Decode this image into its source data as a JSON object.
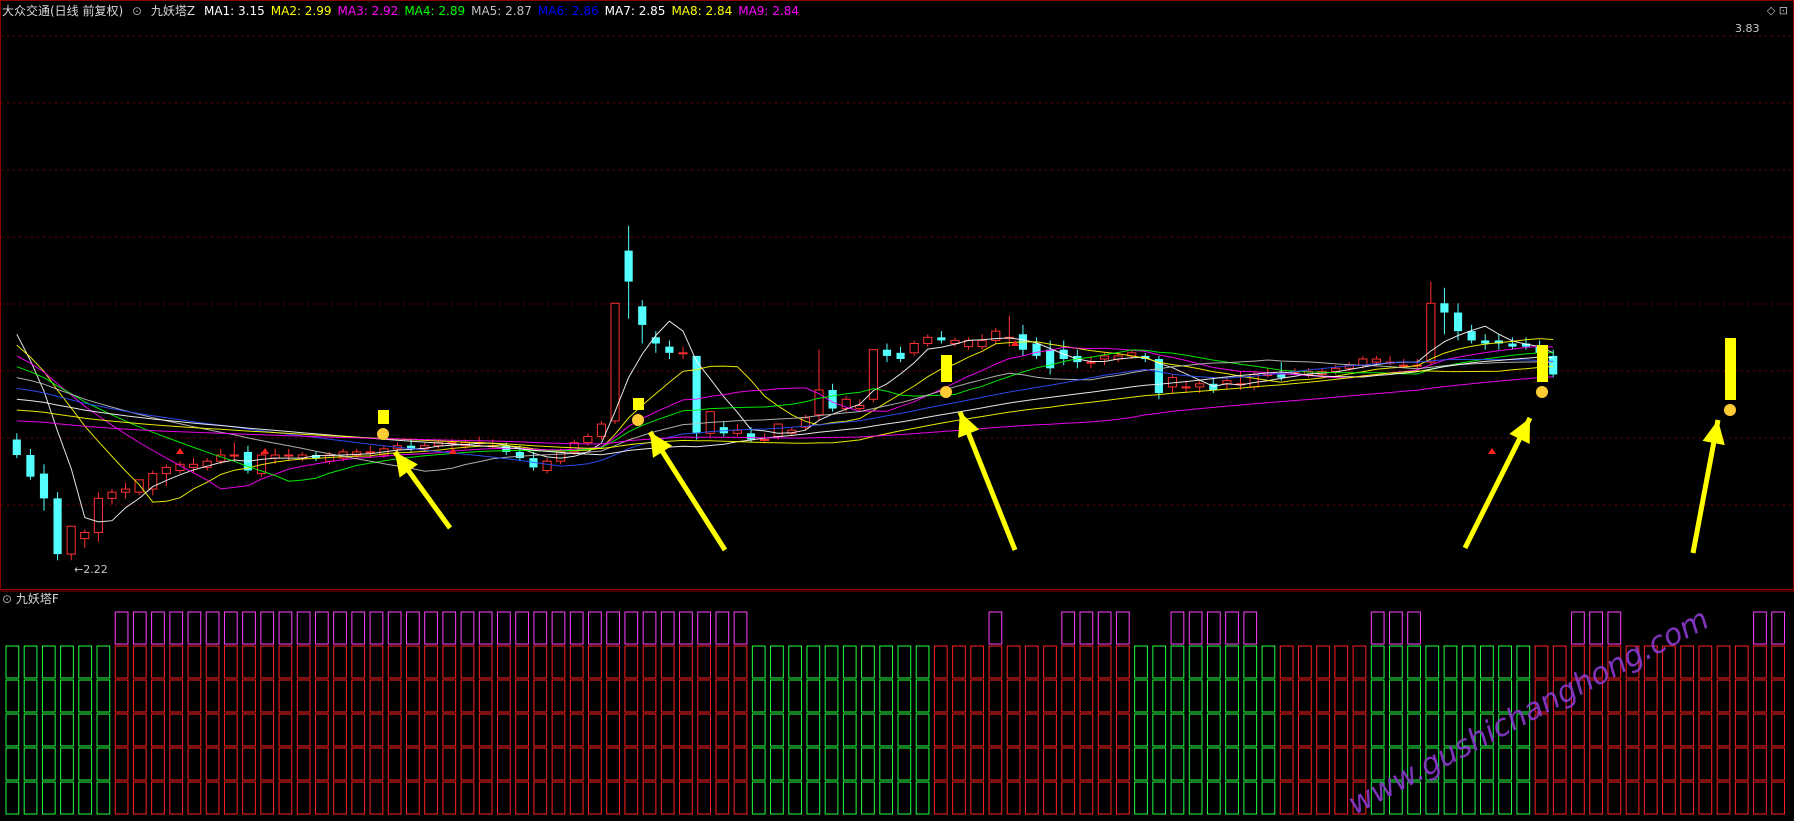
{
  "header": {
    "stock": "大众交通(日线 前复权)",
    "indicator": "九妖塔Z",
    "ma": [
      {
        "label": "MA1: 3.15",
        "color": "#ffffff"
      },
      {
        "label": "MA2: 2.99",
        "color": "#ffff00"
      },
      {
        "label": "MA3: 2.92",
        "color": "#ff00ff"
      },
      {
        "label": "MA4: 2.89",
        "color": "#00ff00"
      },
      {
        "label": "MA5: 2.87",
        "color": "#c0c0c0"
      },
      {
        "label": "MA6: 2.86",
        "color": "#0000ff"
      },
      {
        "label": "MA7: 2.85",
        "color": "#ffffff"
      },
      {
        "label": "MA8: 2.84",
        "color": "#ffff00"
      },
      {
        "label": "MA9: 2.84",
        "color": "#ff00ff"
      }
    ]
  },
  "sub_panel": {
    "title": "九妖塔F"
  },
  "watermark": "www.gushichanghong.com",
  "chart_data": {
    "type": "candlestick",
    "price_high_label": "3.83",
    "price_low_label": "←2.22",
    "ylim": [
      2.15,
      3.9
    ],
    "candles": [
      [
        2.61,
        2.63,
        2.56,
        2.55
      ],
      [
        2.56,
        2.58,
        2.49,
        2.48
      ],
      [
        2.5,
        2.53,
        2.42,
        2.38
      ],
      [
        2.42,
        2.44,
        2.24,
        2.22
      ],
      [
        2.24,
        2.33,
        2.33,
        2.22
      ],
      [
        2.29,
        2.32,
        2.31,
        2.26
      ],
      [
        2.31,
        2.44,
        2.42,
        2.28
      ],
      [
        2.42,
        2.45,
        2.44,
        2.4
      ],
      [
        2.44,
        2.47,
        2.45,
        2.42
      ],
      [
        2.44,
        2.48,
        2.48,
        2.43
      ],
      [
        2.45,
        2.51,
        2.5,
        2.43
      ],
      [
        2.5,
        2.53,
        2.52,
        2.46
      ],
      [
        2.51,
        2.54,
        2.53,
        2.5
      ],
      [
        2.52,
        2.55,
        2.53,
        2.5
      ],
      [
        2.52,
        2.55,
        2.54,
        2.51
      ],
      [
        2.54,
        2.58,
        2.56,
        2.53
      ],
      [
        2.56,
        2.6,
        2.56,
        2.54
      ],
      [
        2.57,
        2.59,
        2.51,
        2.5
      ],
      [
        2.5,
        2.57,
        2.56,
        2.49
      ],
      [
        2.55,
        2.58,
        2.56,
        2.53
      ],
      [
        2.56,
        2.58,
        2.56,
        2.54
      ],
      [
        2.55,
        2.57,
        2.56,
        2.54
      ],
      [
        2.56,
        2.57,
        2.55,
        2.54
      ],
      [
        2.54,
        2.57,
        2.56,
        2.53
      ],
      [
        2.55,
        2.58,
        2.57,
        2.54
      ],
      [
        2.56,
        2.58,
        2.57,
        2.55
      ],
      [
        2.57,
        2.59,
        2.57,
        2.55
      ],
      [
        2.56,
        2.59,
        2.58,
        2.55
      ],
      [
        2.58,
        2.6,
        2.59,
        2.56
      ],
      [
        2.59,
        2.61,
        2.58,
        2.57
      ],
      [
        2.58,
        2.6,
        2.59,
        2.57
      ],
      [
        2.59,
        2.61,
        2.6,
        2.58
      ],
      [
        2.6,
        2.61,
        2.6,
        2.58
      ],
      [
        2.59,
        2.61,
        2.6,
        2.58
      ],
      [
        2.6,
        2.62,
        2.6,
        2.59
      ],
      [
        2.59,
        2.61,
        2.59,
        2.58
      ],
      [
        2.59,
        2.6,
        2.57,
        2.56
      ],
      [
        2.57,
        2.59,
        2.55,
        2.54
      ],
      [
        2.55,
        2.57,
        2.52,
        2.51
      ],
      [
        2.51,
        2.55,
        2.54,
        2.5
      ],
      [
        2.54,
        2.58,
        2.57,
        2.53
      ],
      [
        2.57,
        2.61,
        2.6,
        2.56
      ],
      [
        2.6,
        2.63,
        2.62,
        2.59
      ],
      [
        2.62,
        2.67,
        2.66,
        2.61
      ],
      [
        2.67,
        3.05,
        3.05,
        2.66
      ],
      [
        3.22,
        3.3,
        3.12,
        3.0
      ],
      [
        3.04,
        3.06,
        2.98,
        2.92
      ],
      [
        2.94,
        2.96,
        2.92,
        2.89
      ],
      [
        2.91,
        2.93,
        2.89,
        2.87
      ],
      [
        2.89,
        2.91,
        2.89,
        2.87
      ],
      [
        2.88,
        2.88,
        2.63,
        2.61
      ],
      [
        2.63,
        2.7,
        2.7,
        2.62
      ],
      [
        2.65,
        2.67,
        2.63,
        2.62
      ],
      [
        2.63,
        2.66,
        2.64,
        2.62
      ],
      [
        2.63,
        2.65,
        2.61,
        2.6
      ],
      [
        2.61,
        2.63,
        2.61,
        2.6
      ],
      [
        2.62,
        2.66,
        2.66,
        2.61
      ],
      [
        2.63,
        2.65,
        2.64,
        2.62
      ],
      [
        2.65,
        2.69,
        2.68,
        2.64
      ],
      [
        2.69,
        2.9,
        2.77,
        2.67
      ],
      [
        2.77,
        2.79,
        2.71,
        2.7
      ],
      [
        2.71,
        2.75,
        2.74,
        2.7
      ],
      [
        2.71,
        2.74,
        2.72,
        2.7
      ],
      [
        2.74,
        2.9,
        2.9,
        2.73
      ],
      [
        2.9,
        2.92,
        2.88,
        2.86
      ],
      [
        2.89,
        2.91,
        2.87,
        2.86
      ],
      [
        2.89,
        2.93,
        2.92,
        2.88
      ],
      [
        2.92,
        2.95,
        2.94,
        2.91
      ],
      [
        2.94,
        2.96,
        2.93,
        2.92
      ],
      [
        2.92,
        2.94,
        2.93,
        2.91
      ],
      [
        2.91,
        2.94,
        2.93,
        2.9
      ],
      [
        2.91,
        2.95,
        2.93,
        2.9
      ],
      [
        2.93,
        2.97,
        2.96,
        2.92
      ],
      [
        2.94,
        3.01,
        2.94,
        2.91
      ],
      [
        2.95,
        2.98,
        2.9,
        2.88
      ],
      [
        2.92,
        2.94,
        2.88,
        2.87
      ],
      [
        2.9,
        2.93,
        2.84,
        2.82
      ],
      [
        2.9,
        2.93,
        2.87,
        2.85
      ],
      [
        2.88,
        2.9,
        2.86,
        2.84
      ],
      [
        2.86,
        2.88,
        2.86,
        2.84
      ],
      [
        2.87,
        2.89,
        2.88,
        2.85
      ],
      [
        2.87,
        2.89,
        2.88,
        2.86
      ],
      [
        2.88,
        2.9,
        2.89,
        2.87
      ],
      [
        2.88,
        2.89,
        2.87,
        2.86
      ],
      [
        2.87,
        2.88,
        2.76,
        2.74
      ],
      [
        2.78,
        2.82,
        2.81,
        2.76
      ],
      [
        2.78,
        2.8,
        2.78,
        2.76
      ],
      [
        2.78,
        2.8,
        2.79,
        2.76
      ],
      [
        2.79,
        2.81,
        2.77,
        2.76
      ],
      [
        2.79,
        2.81,
        2.8,
        2.77
      ],
      [
        2.79,
        2.83,
        2.79,
        2.77
      ],
      [
        2.78,
        2.83,
        2.82,
        2.77
      ],
      [
        2.82,
        2.84,
        2.82,
        2.81
      ],
      [
        2.82,
        2.86,
        2.81,
        2.8
      ],
      [
        2.83,
        2.84,
        2.83,
        2.82
      ],
      [
        2.82,
        2.84,
        2.83,
        2.81
      ],
      [
        2.82,
        2.84,
        2.83,
        2.81
      ],
      [
        2.83,
        2.85,
        2.84,
        2.82
      ],
      [
        2.84,
        2.86,
        2.85,
        2.83
      ],
      [
        2.85,
        2.88,
        2.87,
        2.84
      ],
      [
        2.86,
        2.88,
        2.87,
        2.85
      ],
      [
        2.86,
        2.88,
        2.86,
        2.85
      ],
      [
        2.85,
        2.87,
        2.85,
        2.84
      ],
      [
        2.85,
        2.87,
        2.85,
        2.84
      ],
      [
        2.86,
        3.12,
        3.05,
        2.85
      ],
      [
        3.05,
        3.1,
        3.02,
        2.95
      ],
      [
        3.02,
        3.05,
        2.96,
        2.93
      ],
      [
        2.96,
        2.98,
        2.93,
        2.92
      ],
      [
        2.93,
        2.95,
        2.92,
        2.9
      ],
      [
        2.93,
        2.95,
        2.92,
        2.9
      ],
      [
        2.92,
        2.94,
        2.91,
        2.9
      ],
      [
        2.92,
        2.94,
        2.91,
        2.9
      ],
      [
        2.91,
        2.93,
        2.89,
        2.88
      ],
      [
        2.88,
        2.9,
        2.82,
        2.81
      ]
    ],
    "volume_pattern_note": "sub-panel shows stacked tower bars (magenta top, red/green stack)"
  }
}
